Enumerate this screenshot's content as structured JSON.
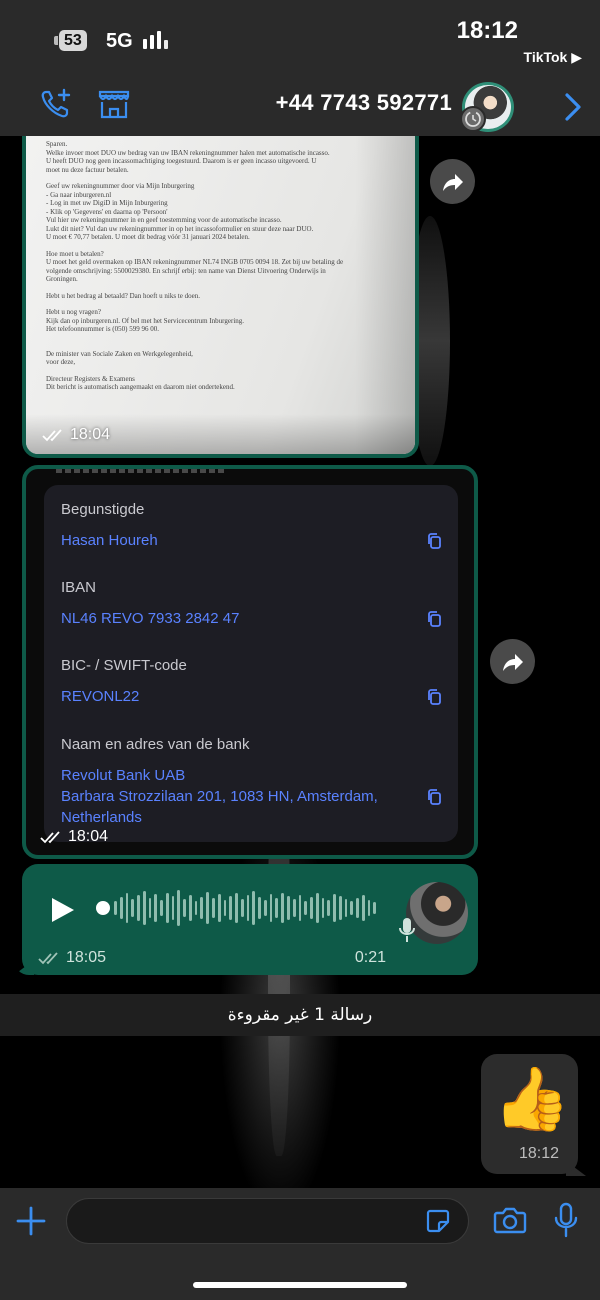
{
  "status_bar": {
    "battery": "53",
    "network": "5G",
    "time": "18:12",
    "back_app": "TikTok ▶"
  },
  "header": {
    "phone_number": "+44 7743 592771"
  },
  "document_image": {
    "lines": [
      "Sparen.",
      "Welke invoer moet DUO uw bedrag van uw IBAN rekeningnummer halen met automatische incasso.",
      "U heeft DUO nog geen incassomachtiging toegestuurd. Daarom is er geen incasso uitgevoerd. U",
      "moet nu deze factuur betalen.",
      "",
      "Geef uw rekeningnummer door via Mijn Inburgering",
      "- Ga naar inburgeren.nl",
      "- Log in met uw DigiD in Mijn Inburgering",
      "- Klik op 'Gegevens' en daarna op 'Persoon'",
      "Vul hier uw rekeningnummer in en geef toestemming voor de automatische incasso.",
      "Lukt dit niet? Vul dan uw rekeningnummer in op het incassoformulier en stuur deze naar DUO.",
      "U moet € 70,77 betalen. U moet dit bedrag vóór 31 januari 2024 betalen.",
      "",
      "Hoe moet u betalen?",
      "U moet het geld overmaken op IBAN rekeningnummer NL74 INGB 0705 0094 18. Zet bij uw betaling de",
      "volgende omschrijving: 5500029380. En schrijf erbij: ten name van Dienst Uitvoering Onderwijs in",
      "Groningen.",
      "",
      "Hebt u het bedrag al betaald? Dan hoeft u niks te doen.",
      "",
      "Hebt u nog vragen?",
      "Kijk dan op inburgeren.nl. Of bel met het Servicecentrum Inburgering.",
      "Het telefoonnummer is (050) 599 96 00.",
      "",
      "",
      "De minister van Sociale Zaken en Werkgelegenheid,",
      "voor deze,",
      "",
      "Directeur Registers & Examens",
      "Dit bericht is automatisch aangemaakt en daarom niet ondertekend."
    ],
    "time": "18:04"
  },
  "bank_details": {
    "fields": [
      {
        "label": "Begunstigde",
        "value": "Hasan Houreh"
      },
      {
        "label": "IBAN",
        "value": "NL46 REVO 7933 2842 47"
      },
      {
        "label": "BIC- / SWIFT-code",
        "value": "REVONL22"
      },
      {
        "label": "Naam en adres van de bank",
        "value": "Revolut Bank UAB\nBarbara Strozzilaan 201, 1083 HN, Amsterdam,\nNetherlands"
      }
    ],
    "time": "18:04"
  },
  "voice_message": {
    "time": "18:05",
    "duration": "0:21"
  },
  "unread_banner": "رسالة 1 غير مقروءة",
  "incoming_message": {
    "emoji": "👍",
    "time": "18:12"
  },
  "input_bar": {
    "placeholder": ""
  },
  "colors": {
    "outgoing_bubble": "#0e5a48",
    "link_blue": "#5a82ff",
    "ios_blue": "#3b8ef0",
    "bar_bg": "#2a2a2a"
  },
  "icons": [
    "battery-icon",
    "signal-icon",
    "add-call-icon",
    "store-icon",
    "chevron-right-icon",
    "forward-icon",
    "copy-icon",
    "double-check-icon",
    "play-icon",
    "mic-icon",
    "plus-icon",
    "sticker-icon",
    "camera-icon"
  ]
}
